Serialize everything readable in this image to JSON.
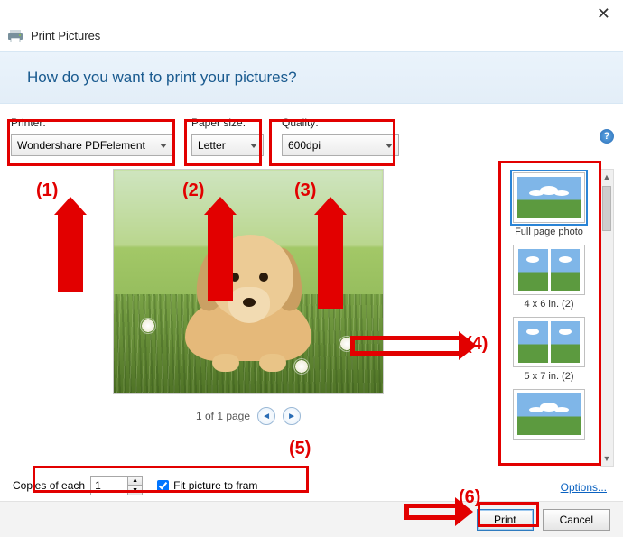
{
  "window": {
    "title": "Print Pictures"
  },
  "banner": {
    "heading": "How do you want to print your pictures?"
  },
  "settings": {
    "printer": {
      "label": "Printer:",
      "value": "Wondershare PDFelement"
    },
    "paper": {
      "label": "Paper size:",
      "value": "Letter"
    },
    "quality": {
      "label": "Quality:",
      "value": "600dpi"
    }
  },
  "pager": {
    "text": "1 of 1 page"
  },
  "templates": [
    {
      "label": "Full page photo",
      "selected": true,
      "layout": "full"
    },
    {
      "label": "4 x 6 in. (2)",
      "selected": false,
      "layout": "two"
    },
    {
      "label": "5 x 7 in. (2)",
      "selected": false,
      "layout": "two"
    },
    {
      "label": "",
      "selected": false,
      "layout": "full"
    }
  ],
  "bottom": {
    "copies_label": "Copies of each",
    "copies_value": "1",
    "fit_label": "Fit picture to fram",
    "fit_checked": true,
    "options_label": "Options..."
  },
  "buttons": {
    "print": "Print",
    "cancel": "Cancel"
  },
  "annotations": {
    "n1": "(1)",
    "n2": "(2)",
    "n3": "(3)",
    "n4": "(4)",
    "n5": "(5)",
    "n6": "(6)"
  }
}
